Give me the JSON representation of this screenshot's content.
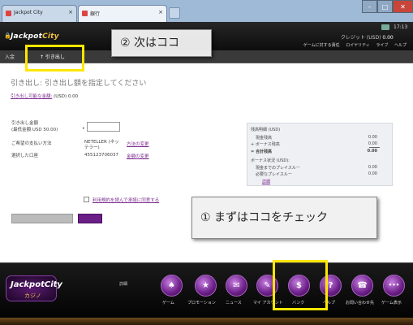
{
  "browser": {
    "tabs": [
      {
        "label": "Jackpot City"
      },
      {
        "label": "銀行"
      }
    ],
    "clock": "17:13"
  },
  "header": {
    "logo_main": "Jackpot",
    "logo_accent": "City",
    "credit_label": "クレジット (USD)",
    "credit_value": "0.00",
    "links": [
      "ゲームに対する責任",
      "ロイヤリティ",
      "ライブ",
      "ヘルプ"
    ]
  },
  "subnav": {
    "deposit_label": "入金",
    "withdraw_label": "↑ 引き出し"
  },
  "content": {
    "heading": "引き出し: 引き出し額を指定してください",
    "available_label": "引き出し可能な金額:",
    "available_value": "(USD) 0.00",
    "amount_label_1": "引き出し金額",
    "amount_label_2": "(最低金額 USD 50.00)",
    "amount_value": "",
    "method_label": "ご希望の支払い方法",
    "method_value_1": "NETELLER (ネッ",
    "method_value_2": "テラー)",
    "method_change": "方法の変更",
    "account_label": "選択した口座",
    "account_value": "455123706037",
    "account_change": "金額の変更",
    "agree_text": "利用規約を読んで承諾に同意する",
    "summary": {
      "title": "残高明細 (USD)",
      "rows": [
        {
          "label": "現金残高",
          "value": "0.00"
        },
        {
          "label": "ボーナス残高",
          "value": "0.00",
          "prefix": "+"
        },
        {
          "label": "合計残高",
          "value": "0.00",
          "prefix": "="
        }
      ],
      "bonus_title": "ボーナス状況 (USD):",
      "bonus_rows": [
        {
          "label": "現金までのプレイスルー",
          "value": "0.00"
        },
        {
          "label": "必要なプレイスルー",
          "value": "0.00"
        }
      ],
      "more": "詳細"
    }
  },
  "bottom_nav": {
    "logo_main": "JackpotCity",
    "logo_sub": "カジノ",
    "detail_label": "詳細",
    "items": [
      {
        "label": "ゲーム",
        "icon": "♠"
      },
      {
        "label": "プロモーション",
        "icon": "★"
      },
      {
        "label": "ニュース",
        "icon": "✉"
      },
      {
        "label": "マイ アカウント",
        "icon": "✎"
      },
      {
        "label": "バンク",
        "icon": "$"
      },
      {
        "label": "ヘルプ",
        "icon": "?"
      },
      {
        "label": "お問い合わせ先",
        "icon": "☎"
      },
      {
        "label": "ゲーム表示",
        "icon": "•••"
      }
    ]
  },
  "callouts": {
    "step2": "② 次はココ",
    "step1": "① まずはココをチェック"
  },
  "colors": {
    "highlight": "#ffe600",
    "accent_purple": "#6a1e86"
  }
}
